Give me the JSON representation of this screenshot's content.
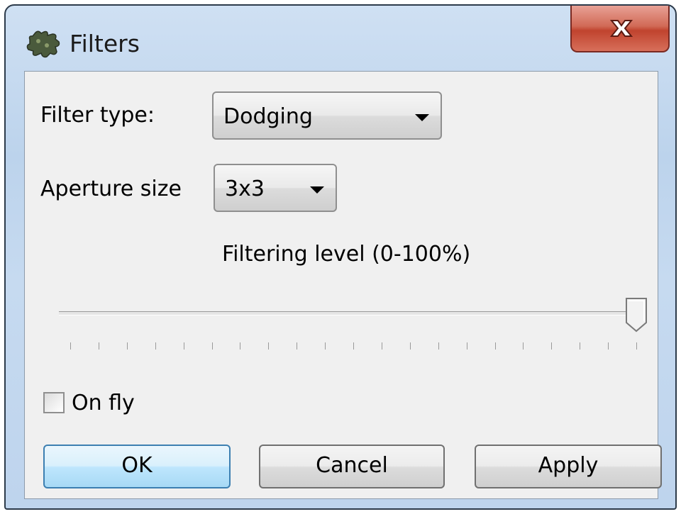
{
  "window": {
    "title": "Filters",
    "icon": "puzzle-icon",
    "close_icon": "close-icon"
  },
  "form": {
    "filter_type_label": "Filter type:",
    "filter_type_value": "Dodging",
    "aperture_label": "Aperture size",
    "aperture_value": "3x3",
    "level_label": "Filtering level (0-100%)",
    "level_value_percent": 100,
    "tick_count": 21,
    "onfly_label": "On fly",
    "onfly_checked": false
  },
  "buttons": {
    "ok": "OK",
    "cancel": "Cancel",
    "apply": "Apply"
  },
  "colors": {
    "title_bar": "#c6daf0",
    "close_button": "#c8503b",
    "default_button_border": "#3c7fb1",
    "client_bg": "#f0f0f0"
  }
}
